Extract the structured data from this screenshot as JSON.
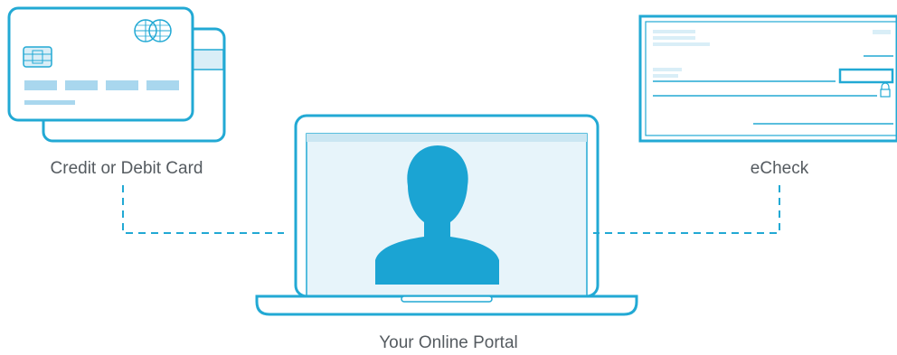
{
  "colors": {
    "outline": "#22a9d4",
    "accent": "#1ba4d3",
    "light_fill": "#d9eef7",
    "screen_fill": "#e7f4fa",
    "text": "#555b60"
  },
  "labels": {
    "card": "Credit or Debit Card",
    "echeck": "eCheck",
    "portal": "Your Online Portal"
  },
  "icons": {
    "card": "credit-card-icon",
    "check": "echeck-icon",
    "portal": "laptop-user-icon",
    "lock": "lock-icon"
  }
}
